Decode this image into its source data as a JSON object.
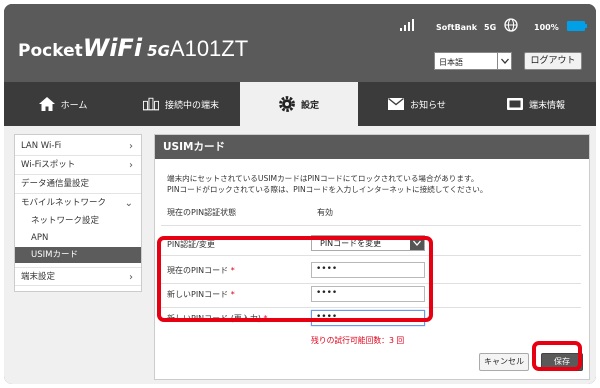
{
  "header": {
    "logo_pocket": "Pocket",
    "logo_wifi": "WiFi",
    "logo_5g": "5G",
    "logo_model": "A101ZT",
    "carrier": "SoftBank",
    "network": "5G",
    "battery": "100%",
    "language": "日本語",
    "logout_label": "ログアウト",
    "accent": "#00a0e9"
  },
  "nav": {
    "items": [
      {
        "label": "ホーム",
        "icon": "home-icon"
      },
      {
        "label": "接続中の端末",
        "icon": "devices-icon"
      },
      {
        "label": "設定",
        "icon": "gear-icon"
      },
      {
        "label": "お知らせ",
        "icon": "mail-icon"
      },
      {
        "label": "端末情報",
        "icon": "device-info-icon"
      }
    ]
  },
  "sidebar": {
    "items": [
      {
        "label": "LAN Wi-Fi"
      },
      {
        "label": "Wi-Fiスポット"
      },
      {
        "label": "データ通信量設定"
      },
      {
        "label": "モバイルネットワーク"
      },
      {
        "label": "ネットワーク設定"
      },
      {
        "label": "APN"
      },
      {
        "label": "USIMカード"
      },
      {
        "label": "端末設定"
      }
    ]
  },
  "content": {
    "title": "USIMカード",
    "desc_line1": "端末内にセットされているUSIMカードはPINコードにてロックされている場合があります。",
    "desc_line2": "PINコードがロックされている際は、PINコードを入力しインターネットに接続してください。",
    "pin_status_label": "現在のPIN認証状態",
    "pin_status_value": "有効",
    "pin_auth_label": "PIN認証/変更",
    "pin_auth_value": "PINコードを変更",
    "current_pin_label": "現在のPINコード",
    "current_pin_value": "••••",
    "new_pin_label": "新しいPINコード",
    "new_pin_value": "••••",
    "new_pin_confirm_label": "新しいPINコード (再入力)",
    "new_pin_confirm_value": "••••",
    "required_mark": "*",
    "remaining": "残りの試行可能回数：3 回",
    "cancel_label": "キャンセル",
    "save_label": "保存",
    "highlight_color": "#e60012"
  }
}
